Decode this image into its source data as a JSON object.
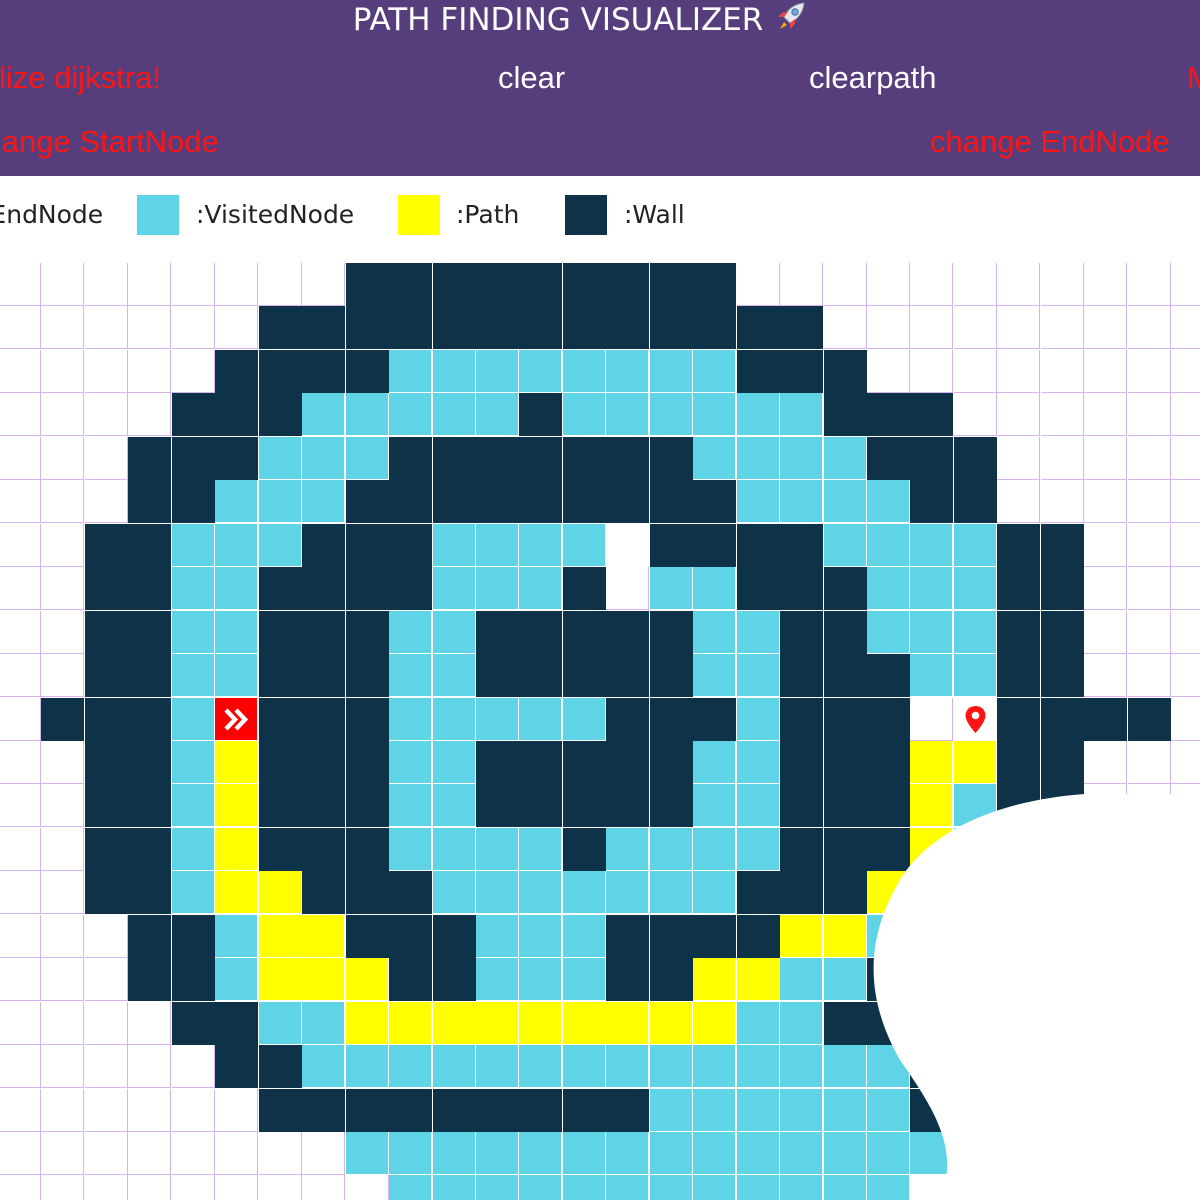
{
  "header": {
    "title": "PATH FINDING VISUALIZER",
    "title_icon": "rocket-icon",
    "buttons": [
      {
        "label": "Visualize dijkstra!"
      },
      {
        "label": "clear"
      },
      {
        "label": "clearpath"
      },
      {
        "label": "M"
      },
      {
        "label": "change StartNode"
      },
      {
        "label": "change EndNode"
      }
    ]
  },
  "legend": {
    "end_label": ":EndNode",
    "visited_label": ":VisitedNode",
    "path_label": ":Path",
    "wall_label": ":Wall"
  },
  "colors": {
    "header": "#563d7c",
    "wall": "#0e3349",
    "visited": "#5fd4e6",
    "path": "#ffff00",
    "start": "#ff0000",
    "button_red": "#ff1414",
    "grid_line": "#d7b4f0"
  },
  "grid": {
    "rows_visible": 22,
    "cols_visible": 28,
    "start_icon": "double-chevron-right-icon",
    "end_icon": "map-pin-icon",
    "cells": [
      "........#########...........",
      "......#############.........",
      ".....####VVVVVVVV###........",
      "....###VVVVV#VVVVVV###......",
      "...###VVV#######VVVV###.....",
      "...##VVV#########VVVV##.....",
      "..##VVV###VVVVE####VVVV##...",
      "..##VV####VVV#.VV###VVV##...",
      "..##VV###VV#####VV##VVV##...",
      "..##VV###VV#####VV###VV##...",
      ".###VS###VVVVV###V###.E####.",
      "..##VP###VV#####VV###PP##...",
      "..##VP###VV#####VV###PV##...",
      "..##VP###VVVV#VVVV###PV##...",
      "..##VPP###VVVVVVV###PPV##...",
      "...##VPP###VVV####PPVV##....",
      "...##VPPP##VVV##PPVV###.....",
      "....##VVPPPPPPPPPVV###......",
      ".....##VVVVVVVVVVVVVV#......",
      "......#########VVVVVV#......",
      "........VVVVVVVVVVVVVV......",
      ".........VVVVVVVVVVVV......."
    ]
  }
}
